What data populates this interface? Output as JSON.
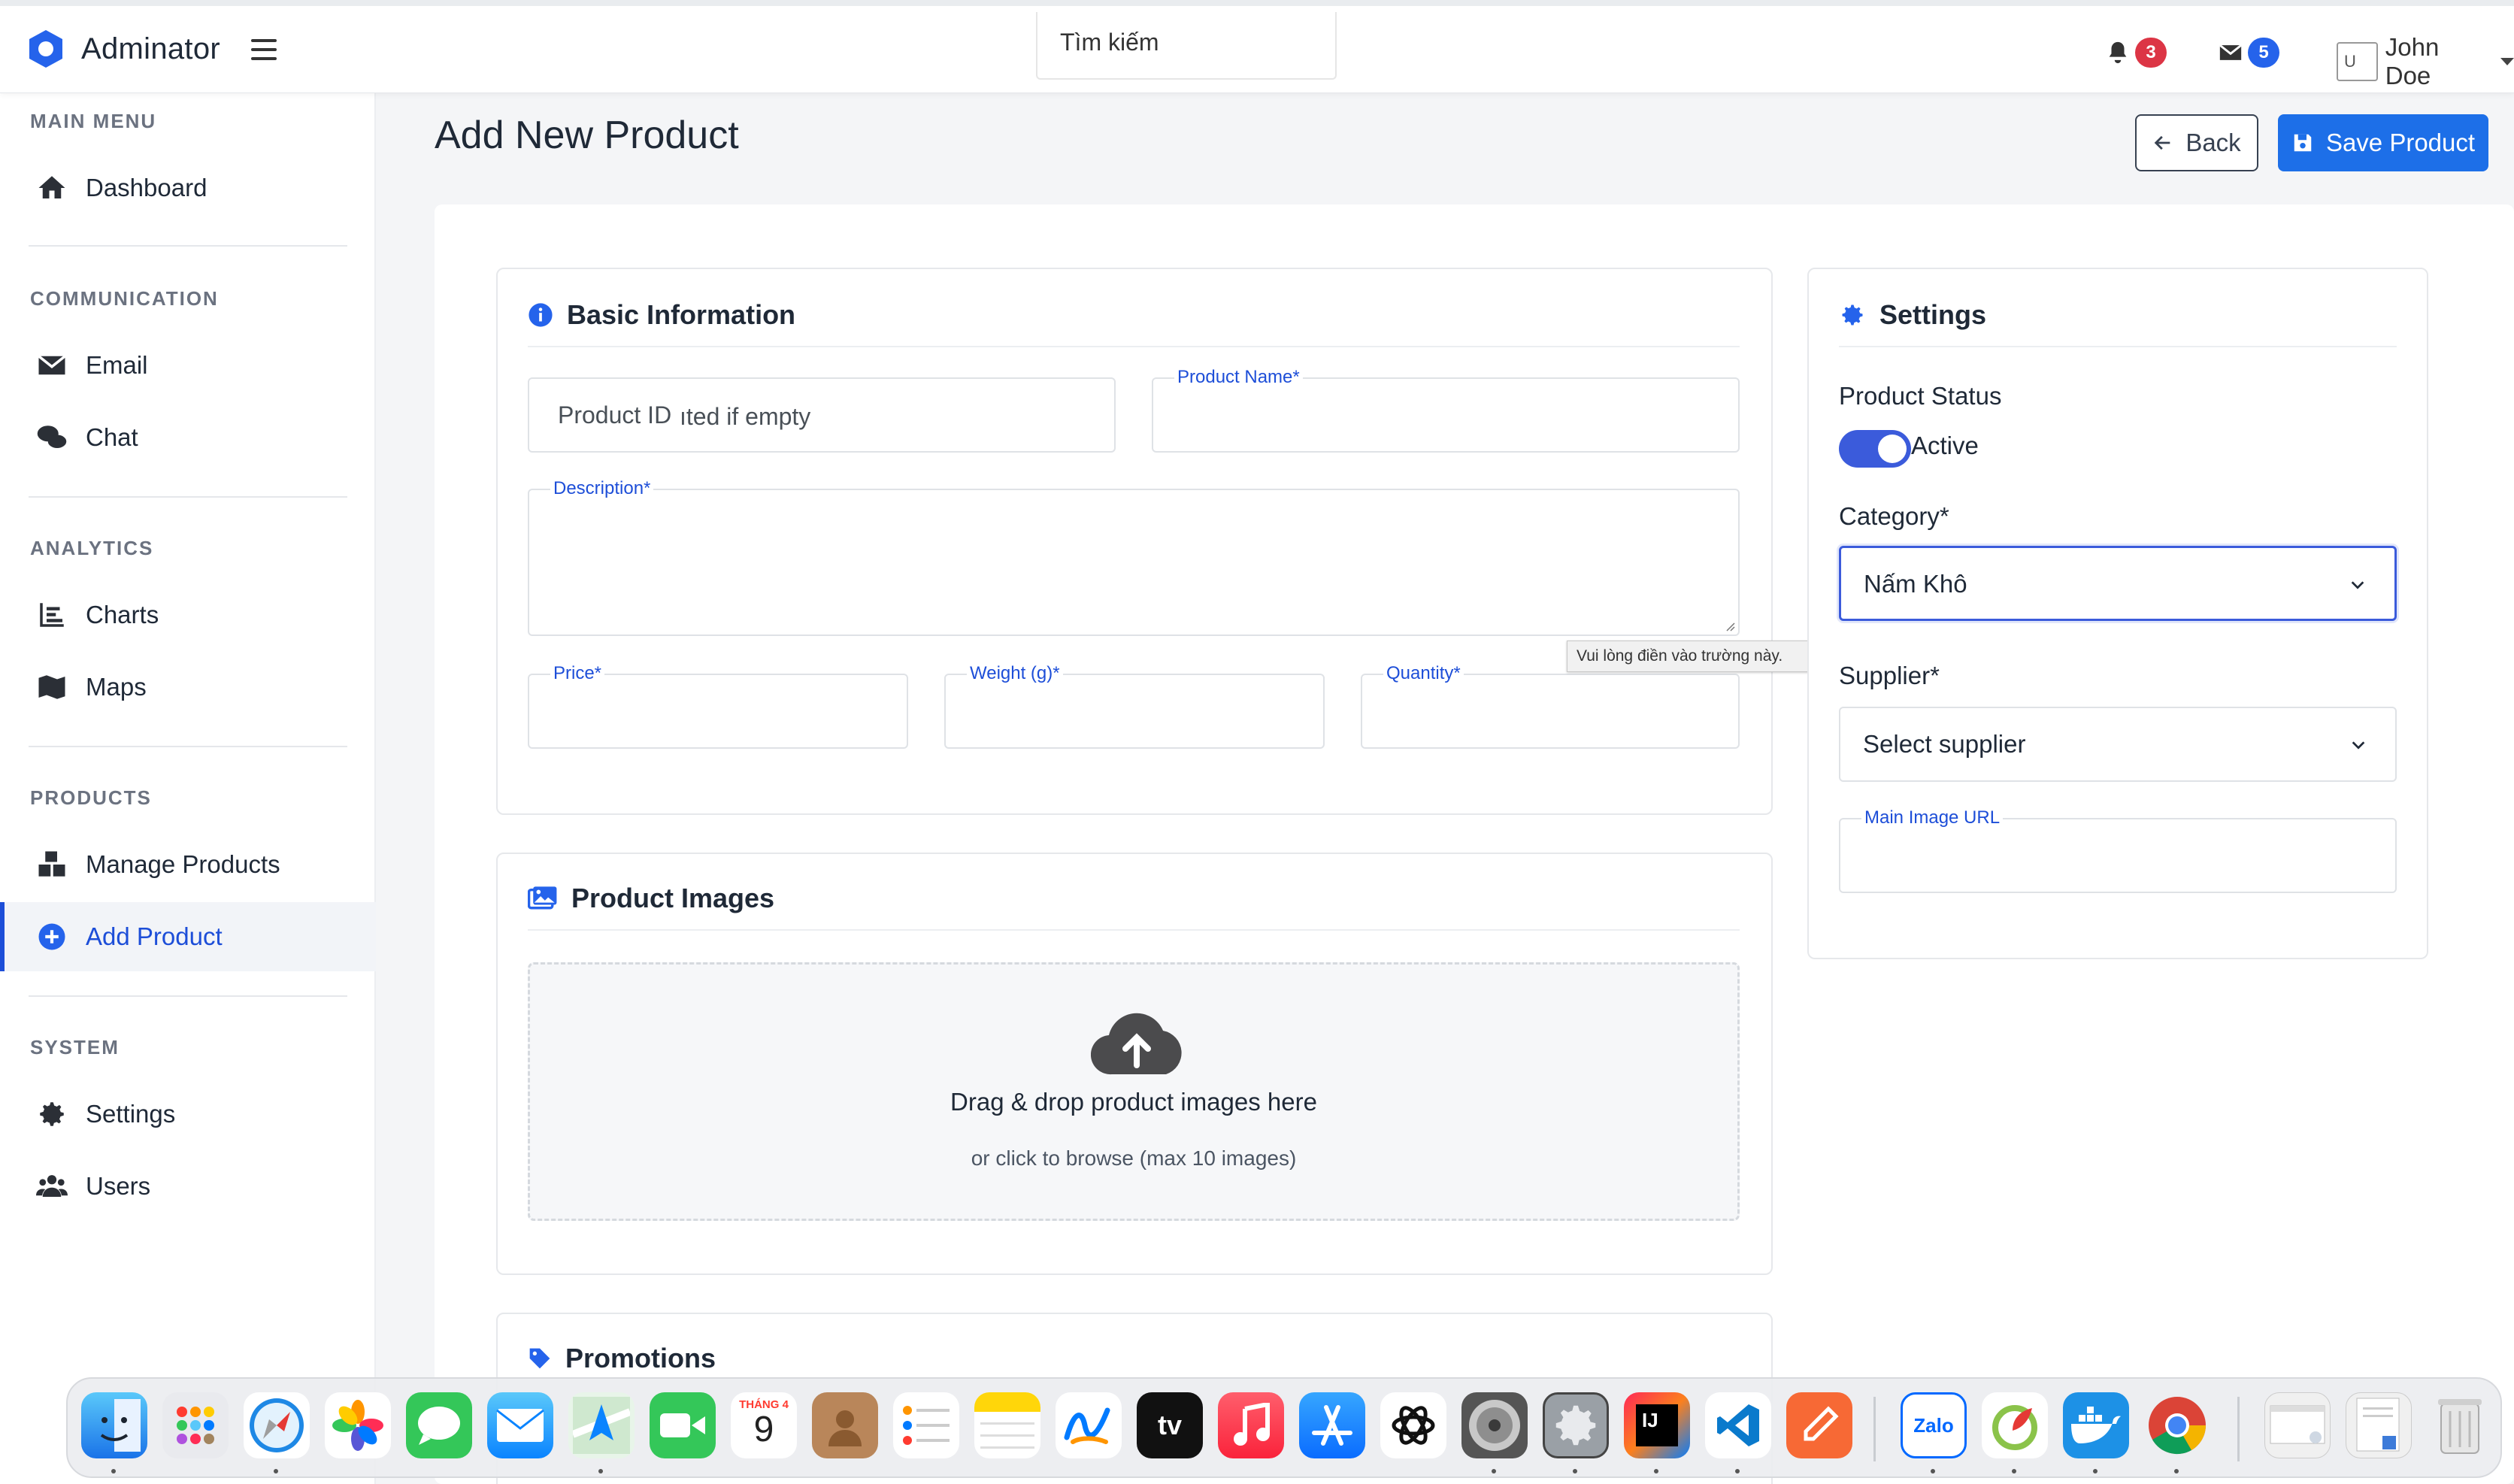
{
  "app": {
    "name": "Adminator"
  },
  "search": {
    "placeholder": "Tìm kiếm"
  },
  "notifications": {
    "bell_count": "3",
    "mail_count": "5"
  },
  "user": {
    "avatar_alt": "U",
    "name": "John Doe"
  },
  "sidebar": {
    "sections": [
      {
        "title": "MAIN MENU",
        "items": [
          {
            "label": "Dashboard",
            "icon": "home-icon"
          }
        ]
      },
      {
        "title": "COMMUNICATION",
        "items": [
          {
            "label": "Email",
            "icon": "envelope-icon"
          },
          {
            "label": "Chat",
            "icon": "chat-icon"
          }
        ]
      },
      {
        "title": "ANALYTICS",
        "items": [
          {
            "label": "Charts",
            "icon": "chart-icon"
          },
          {
            "label": "Maps",
            "icon": "map-icon"
          }
        ]
      },
      {
        "title": "PRODUCTS",
        "items": [
          {
            "label": "Manage Products",
            "icon": "boxes-icon"
          },
          {
            "label": "Add Product",
            "icon": "plus-circle-icon",
            "active": true
          }
        ]
      },
      {
        "title": "SYSTEM",
        "items": [
          {
            "label": "Settings",
            "icon": "gear-icon"
          },
          {
            "label": "Users",
            "icon": "users-icon"
          }
        ]
      }
    ]
  },
  "page": {
    "title": "Add New Product",
    "back_label": "Back",
    "save_label": "Save Product"
  },
  "basic_info": {
    "title": "Basic Information",
    "product_id_placeholder": "Product ID",
    "product_id_hint": "ıted if empty",
    "product_name_label": "Product Name*",
    "description_label": "Description*",
    "price_label": "Price*",
    "weight_label": "Weight (g)*",
    "quantity_label": "Quantity*",
    "tooltip": "Vui lòng điền vào trường này."
  },
  "images": {
    "title": "Product Images",
    "drop_text": "Drag & drop product images here",
    "browse_text": "or click to browse (max 10 images)"
  },
  "promotions": {
    "title": "Promotions"
  },
  "settings": {
    "title": "Settings",
    "status_label": "Product Status",
    "status_value": "Active",
    "status_on": true,
    "category_label": "Category*",
    "category_value": "Nấm Khô",
    "supplier_label": "Supplier*",
    "supplier_value": "Select supplier",
    "main_image_label": "Main Image URL"
  },
  "dock": {
    "apps": [
      "Finder",
      "Launchpad",
      "Safari",
      "Photos",
      "Messages",
      "Mail",
      "Maps",
      "FaceTime",
      "Calendar",
      "Contacts",
      "Reminders",
      "Notes",
      "Freeform",
      "TV",
      "Music",
      "App Store",
      "ChatGPT",
      "Disk Utility",
      "System Settings",
      "IntelliJ IDEA",
      "VS Code",
      "Postman",
      "Zalo",
      "Git Tool",
      "Docker",
      "Chrome",
      "Documents",
      "Downloads",
      "Trash"
    ],
    "calendar_month": "THÁNG 4",
    "calendar_day": "9",
    "tv_label": "tv",
    "ij_label": "IJ",
    "zalo_label": "Zalo"
  },
  "colors": {
    "primary": "#1d6fe8",
    "accent": "#3b5bdb",
    "badge_red": "#dc3545",
    "badge_blue": "#2563eb"
  }
}
